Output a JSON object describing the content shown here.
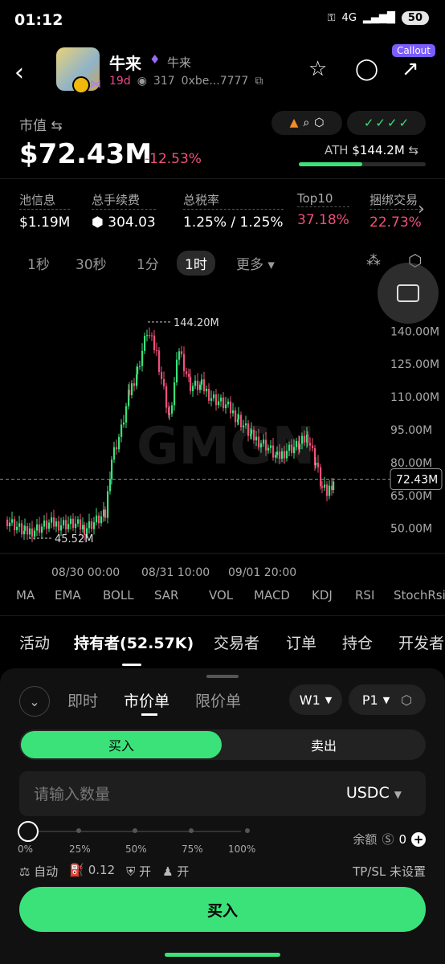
{
  "status": {
    "time": "01:12",
    "net": "4G",
    "battery": "50"
  },
  "token": {
    "name": "牛来",
    "alias": "牛来",
    "age": "19d",
    "watchers": "317",
    "address": "0xbe...7777",
    "callout": "Callout"
  },
  "mcap": {
    "label": "市值",
    "value": "$72.43M",
    "change": "-12.53%",
    "ath_label": "ATH",
    "ath_value": "$144.2M",
    "ath_progress": 0.5
  },
  "stats": [
    {
      "label": "池信息",
      "value": "$1.19M"
    },
    {
      "label": "总手续费",
      "value": "304.03"
    },
    {
      "label": "总税率",
      "value": "1.25% / 1.25%"
    },
    {
      "label": "Top10",
      "value": "37.18%"
    },
    {
      "label": "捆绑交易",
      "value": "22.73%"
    }
  ],
  "timeframes": [
    "1秒",
    "30秒",
    "1分",
    "1时",
    "更多"
  ],
  "selected_timeframe": "1时",
  "chart_data": {
    "type": "candlestick",
    "price_axis": [
      "140.00M",
      "125.00M",
      "110.00M",
      "95.00M",
      "80.00M",
      "65.00M",
      "50.00M"
    ],
    "time_axis": [
      "08/30 00:00",
      "08/31 10:00",
      "09/01 20:00"
    ],
    "high_label": "144.20M",
    "low_label": "45.52M",
    "current_label": "72.43M",
    "high": 144.2,
    "low": 45.52,
    "current": 72.43,
    "ylim": [
      40,
      150
    ]
  },
  "indicators": [
    "MA",
    "EMA",
    "BOLL",
    "SAR",
    "VOL",
    "MACD",
    "KDJ",
    "RSI",
    "StochRsi"
  ],
  "tabs": [
    "活动",
    "持有者",
    "交易者",
    "订单",
    "持仓",
    "开发者"
  ],
  "holders_count": "(52.57K)",
  "order": {
    "types": [
      "即时",
      "市价单",
      "限价单"
    ],
    "w_label": "W1",
    "p_label": "P1",
    "buy_label": "买入",
    "sell_label": "卖出",
    "amount_placeholder": "请输入数量",
    "currency": "USDC",
    "percents": [
      "0%",
      "25%",
      "50%",
      "75%",
      "100%"
    ],
    "balance_label": "余额",
    "balance_value": "0",
    "auto_label": "自动",
    "gas": "0.12",
    "opt1": "开",
    "opt2": "开",
    "tpsl": "TP/SL 未设置",
    "submit": "买入"
  }
}
